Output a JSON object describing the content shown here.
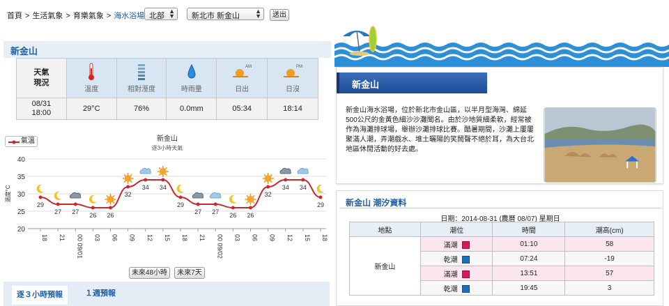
{
  "breadcrumb": {
    "items": [
      "首頁",
      "生活氣象",
      "育樂氣象",
      "海水浴場"
    ],
    "separator": ">"
  },
  "filters": {
    "region_value": "北部",
    "location_value": "新北市 新金山",
    "submit_label": "送出"
  },
  "weather": {
    "location_title": "新金山",
    "row_header": "天氣現況",
    "columns": [
      {
        "label": "溫度",
        "icon": "thermometer-icon"
      },
      {
        "label": "相對溼度",
        "icon": "humidity-icon"
      },
      {
        "label": "時雨量",
        "icon": "raindrop-icon"
      },
      {
        "label": "日出",
        "icon": "sunrise-icon",
        "tag": "AM"
      },
      {
        "label": "日沒",
        "icon": "sunset-icon",
        "tag": "PM"
      }
    ],
    "datetime_date": "08/31",
    "datetime_time": "18:00",
    "values": [
      "29°C",
      "76%",
      "0.0mm",
      "05:34",
      "18:14"
    ]
  },
  "chart_data": {
    "type": "line",
    "title": "新金山",
    "subtitle": "逐3小時天氣",
    "ylabel": "溫度°C",
    "ylim": [
      20,
      40
    ],
    "yticks": [
      20,
      25,
      30,
      35,
      40
    ],
    "xticks": [
      "18",
      "21",
      "00 09/01",
      "03",
      "06",
      "09",
      "12",
      "15",
      "18",
      "21",
      "00 09/02",
      "03",
      "06",
      "09",
      "12",
      "15",
      "18"
    ],
    "series": [
      {
        "name": "氣溫",
        "values": [
          29,
          27,
          27,
          26,
          26,
          32,
          34,
          34,
          29,
          27,
          27,
          26,
          26,
          32,
          34,
          34,
          29
        ]
      }
    ],
    "weather_icons": [
      "moon",
      "moon",
      "cloudy-night",
      "moon",
      "sun",
      "sun",
      "cloud",
      "sun",
      "moon",
      "cloudy-night",
      "cloud",
      "moon",
      "sun",
      "sun",
      "cloudy-night",
      "cloud",
      "moon"
    ],
    "legend_label": "氣溫",
    "colors": {
      "line": "#c9282d",
      "grid": "#dddddd"
    }
  },
  "chart_buttons": {
    "next48": "未來48小時",
    "next7": "未來7天"
  },
  "tabs": [
    "逐３小時預報",
    "１週預報"
  ],
  "beach": {
    "title": "新金山",
    "description": "新金山海水浴場，位於新北市金山區，以半月型海灣、綿延500公尺的金黃色細沙沙灘聞名。由於沙地質細柔軟，經常被作為海灘排球場，舉辦沙灘排球比賽。酷暑期間，沙灘上屢屢聚滿人潮，弄潮戲水、堆土曬陽的笑鬧聲不絕於耳，為大台北地區休閒活動的好去處。"
  },
  "tide": {
    "title": "新金山 潮汐資料",
    "date_line": "日期：2014-08-31 (農曆 08/07) 星期日",
    "headers": [
      "地點",
      "潮位",
      "時間",
      "潮高(cm)"
    ],
    "location": "新金山",
    "rows": [
      {
        "level": "滿潮",
        "time": "01:10",
        "height": "58",
        "kind": "high"
      },
      {
        "level": "乾潮",
        "time": "07:24",
        "height": "-19",
        "kind": "low"
      },
      {
        "level": "滿潮",
        "time": "13:51",
        "height": "57",
        "kind": "high"
      },
      {
        "level": "乾潮",
        "time": "19:45",
        "height": "3",
        "kind": "low"
      }
    ]
  },
  "colors": {
    "accent": "#1f5fa6",
    "wave": "#2b8fd9",
    "title_bar": "#2a5ca8",
    "high_tide": "#d8175d",
    "low_tide": "#1a6fc4"
  }
}
